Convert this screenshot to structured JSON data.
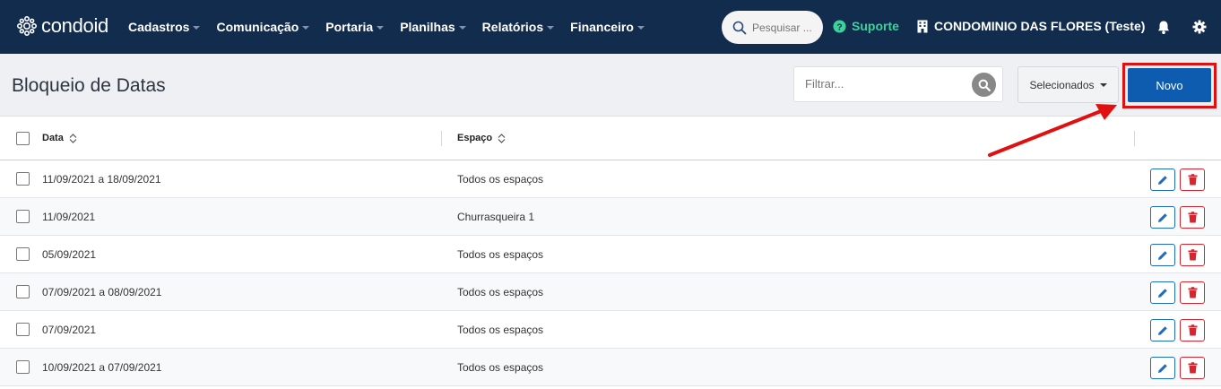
{
  "app": {
    "brand": "condoid"
  },
  "nav": [
    {
      "label": "Cadastros"
    },
    {
      "label": "Comunicação"
    },
    {
      "label": "Portaria"
    },
    {
      "label": "Planilhas"
    },
    {
      "label": "Relatórios"
    },
    {
      "label": "Financeiro"
    }
  ],
  "search": {
    "placeholder": "Pesquisar ..."
  },
  "support": {
    "label": "Suporte"
  },
  "condo": {
    "name": "CONDOMINIO DAS FLORES (Teste)"
  },
  "page": {
    "title": "Bloqueio de Datas",
    "filter_placeholder": "Filtrar...",
    "selected_label": "Selecionados",
    "new_label": "Novo"
  },
  "table": {
    "columns": [
      "Data",
      "Espaço"
    ],
    "rows": [
      {
        "data": "11/09/2021 a 18/09/2021",
        "espaco": "Todos os espaços"
      },
      {
        "data": "11/09/2021",
        "espaco": "Churrasqueira 1"
      },
      {
        "data": "05/09/2021",
        "espaco": "Todos os espaços"
      },
      {
        "data": "07/09/2021 a 08/09/2021",
        "espaco": "Todos os espaços"
      },
      {
        "data": "07/09/2021",
        "espaco": "Todos os espaços"
      },
      {
        "data": "10/09/2021 a 07/09/2021",
        "espaco": "Todos os espaços"
      }
    ]
  },
  "colors": {
    "topbar": "#112c4d",
    "primary": "#0d5cb0",
    "support": "#3bd39a",
    "danger": "#d9232d",
    "highlight": "#e01010"
  },
  "icons": [
    "condoid-logo-icon",
    "search-icon",
    "help-circle-icon",
    "building-icon",
    "bell-icon",
    "gear-icon",
    "sort-icon",
    "pencil-icon",
    "trash-icon",
    "annotation-arrow"
  ]
}
